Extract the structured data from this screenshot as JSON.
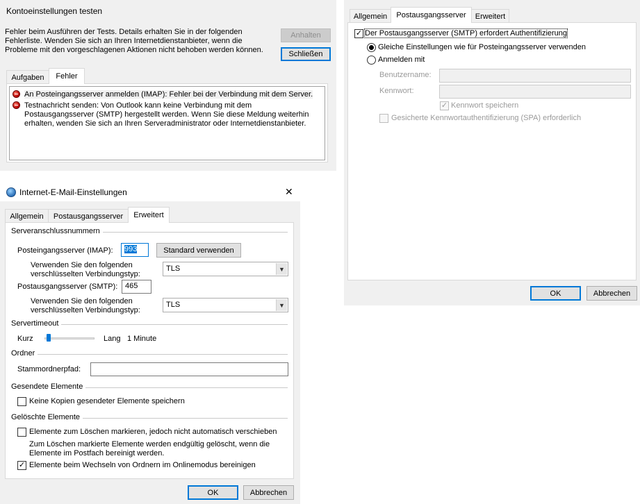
{
  "test_dialog": {
    "title": "Kontoeinstellungen testen",
    "message": "Fehler beim Ausführen der Tests. Details erhalten Sie in der folgenden Fehlerliste. Wenden Sie sich an Ihren Internetdienstanbieter, wenn die Probleme mit den vorgeschlagenen Aktionen nicht behoben werden können.",
    "stop_button": "Anhalten",
    "close_button": "Schließen",
    "tabs": [
      "Aufgaben",
      "Fehler"
    ],
    "active_tab": "Fehler",
    "errors": [
      "An Posteingangsserver anmelden (IMAP): Fehler bei der Verbindung mit dem Server.",
      "Testnachricht senden: Von Outlook kann keine Verbindung mit dem Postausgangsserver (SMTP) hergestellt werden. Wenn Sie diese Meldung weiterhin erhalten, wenden Sie sich an Ihren Serveradministrator oder Internetdienstanbieter."
    ]
  },
  "outgoing_dialog": {
    "tabs": [
      "Allgemein",
      "Postausgangsserver",
      "Erweitert"
    ],
    "active_tab": "Postausgangsserver",
    "requires_auth_label": "Der Postausgangsserver (SMTP) erfordert Authentifizierung",
    "requires_auth_checked": true,
    "same_settings_label": "Gleiche Einstellungen wie für Posteingangsserver verwenden",
    "login_with_label": "Anmelden mit",
    "selected_option": "same_settings",
    "username_label": "Benutzername:",
    "username_value": "",
    "password_label": "Kennwort:",
    "password_value": "",
    "remember_password_label": "Kennwort speichern",
    "remember_password_checked": true,
    "spa_label": "Gesicherte Kennwortauthentifizierung (SPA) erforderlich",
    "spa_checked": false,
    "ok_button": "OK",
    "cancel_button": "Abbrechen"
  },
  "email_settings_dialog": {
    "title": "Internet-E-Mail-Einstellungen",
    "close_glyph": "✕",
    "tabs": [
      "Allgemein",
      "Postausgangsserver",
      "Erweitert"
    ],
    "active_tab": "Erweitert",
    "section_ports": "Serveranschlussnummern",
    "incoming_label": "Posteingangsserver (IMAP):",
    "incoming_port": "993",
    "use_default_button": "Standard verwenden",
    "encryption_label": "Verwenden Sie den folgenden verschlüsselten Verbindungstyp:",
    "incoming_encryption": "TLS",
    "outgoing_label": "Postausgangsserver (SMTP):",
    "outgoing_port": "465",
    "outgoing_encryption": "TLS",
    "section_timeout": "Servertimeout",
    "timeout_short": "Kurz",
    "timeout_long": "Lang",
    "timeout_value": "1 Minute",
    "section_folders": "Ordner",
    "root_folder_label": "Stammordnerpfad:",
    "root_folder_value": "",
    "section_sent": "Gesendete Elemente",
    "no_sent_copies_label": "Keine Kopien gesendeter Elemente speichern",
    "no_sent_copies_checked": false,
    "section_deleted": "Gelöschte Elemente",
    "mark_deleted_label": "Elemente zum Löschen markieren, jedoch nicht automatisch verschieben",
    "mark_deleted_checked": false,
    "mark_deleted_note": "Zum Löschen markierte Elemente werden endgültig gelöscht, wenn die Elemente im Postfach bereinigt werden.",
    "purge_label": "Elemente beim Wechseln von Ordnern im Onlinemodus bereinigen",
    "purge_checked": true,
    "ok_button": "OK",
    "cancel_button": "Abbrechen"
  },
  "icons": {
    "error": "error-icon",
    "globe": "globe-mail-icon",
    "check": "✓",
    "dropdown": "▼"
  }
}
